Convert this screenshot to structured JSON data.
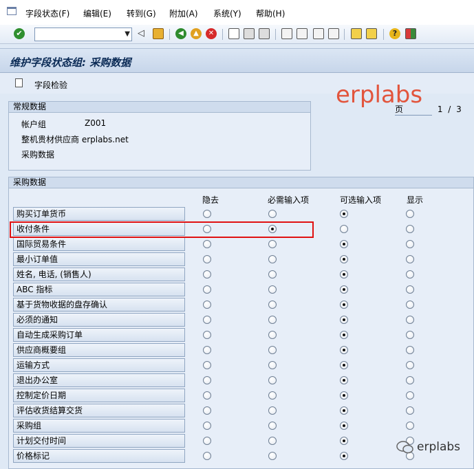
{
  "menubar": {
    "items": [
      "字段状态(F)",
      "编辑(E)",
      "转到(G)",
      "附加(A)",
      "系统(Y)",
      "帮助(H)"
    ]
  },
  "toolbar": {
    "command_value": "",
    "icons": [
      "check-icon",
      "back-icon",
      "save-icon",
      "green-arrow-icon",
      "yellow-arrow-icon",
      "red-cancel-icon",
      "print-icon",
      "find-icon",
      "find-next-icon",
      "first-page-icon",
      "prev-page-icon",
      "next-page-icon",
      "last-page-icon",
      "session-icon",
      "shortcut-icon",
      "help-icon",
      "customize-icon"
    ]
  },
  "title": "维护字段状态组: 采购数据",
  "app_toolbar": {
    "check_label": "字段检验"
  },
  "watermark": "erplabs",
  "pager": {
    "label": "页",
    "current": "1",
    "sep": "/",
    "total": "3"
  },
  "general": {
    "header": "常规数据",
    "rows": [
      {
        "label": "帐户组",
        "value": "Z001"
      },
      {
        "label": "整机贵材供应商 erplabs.net",
        "value": ""
      },
      {
        "label": "采购数据",
        "value": ""
      }
    ]
  },
  "purchasing": {
    "header": "采购数据",
    "columns": [
      "隐去",
      "必需输入项",
      "可选输入项",
      "显示"
    ],
    "fields": [
      {
        "label": "购买订单货币",
        "selected": 2
      },
      {
        "label": "收付条件",
        "selected": 1
      },
      {
        "label": "国际贸易条件",
        "selected": 2
      },
      {
        "label": "最小订单值",
        "selected": 2
      },
      {
        "label": "姓名, 电话, (销售人)",
        "selected": 2
      },
      {
        "label": "ABC 指标",
        "selected": 2
      },
      {
        "label": "基于货物收据的盘存确认",
        "selected": 2
      },
      {
        "label": "必须的通知",
        "selected": 2
      },
      {
        "label": "自动生成采购订单",
        "selected": 2
      },
      {
        "label": "供应商概要组",
        "selected": 2
      },
      {
        "label": "运输方式",
        "selected": 2
      },
      {
        "label": "退出办公室",
        "selected": 2
      },
      {
        "label": "控制定价日期",
        "selected": 2
      },
      {
        "label": "评估收货结算交货",
        "selected": 2
      },
      {
        "label": "采购组",
        "selected": 2
      },
      {
        "label": "计划交付时间",
        "selected": 2
      },
      {
        "label": "价格标记",
        "selected": 2
      }
    ]
  },
  "footer_brand": "erplabs",
  "colors": {
    "highlight": "#e01010",
    "watermark": "#e2553d"
  }
}
